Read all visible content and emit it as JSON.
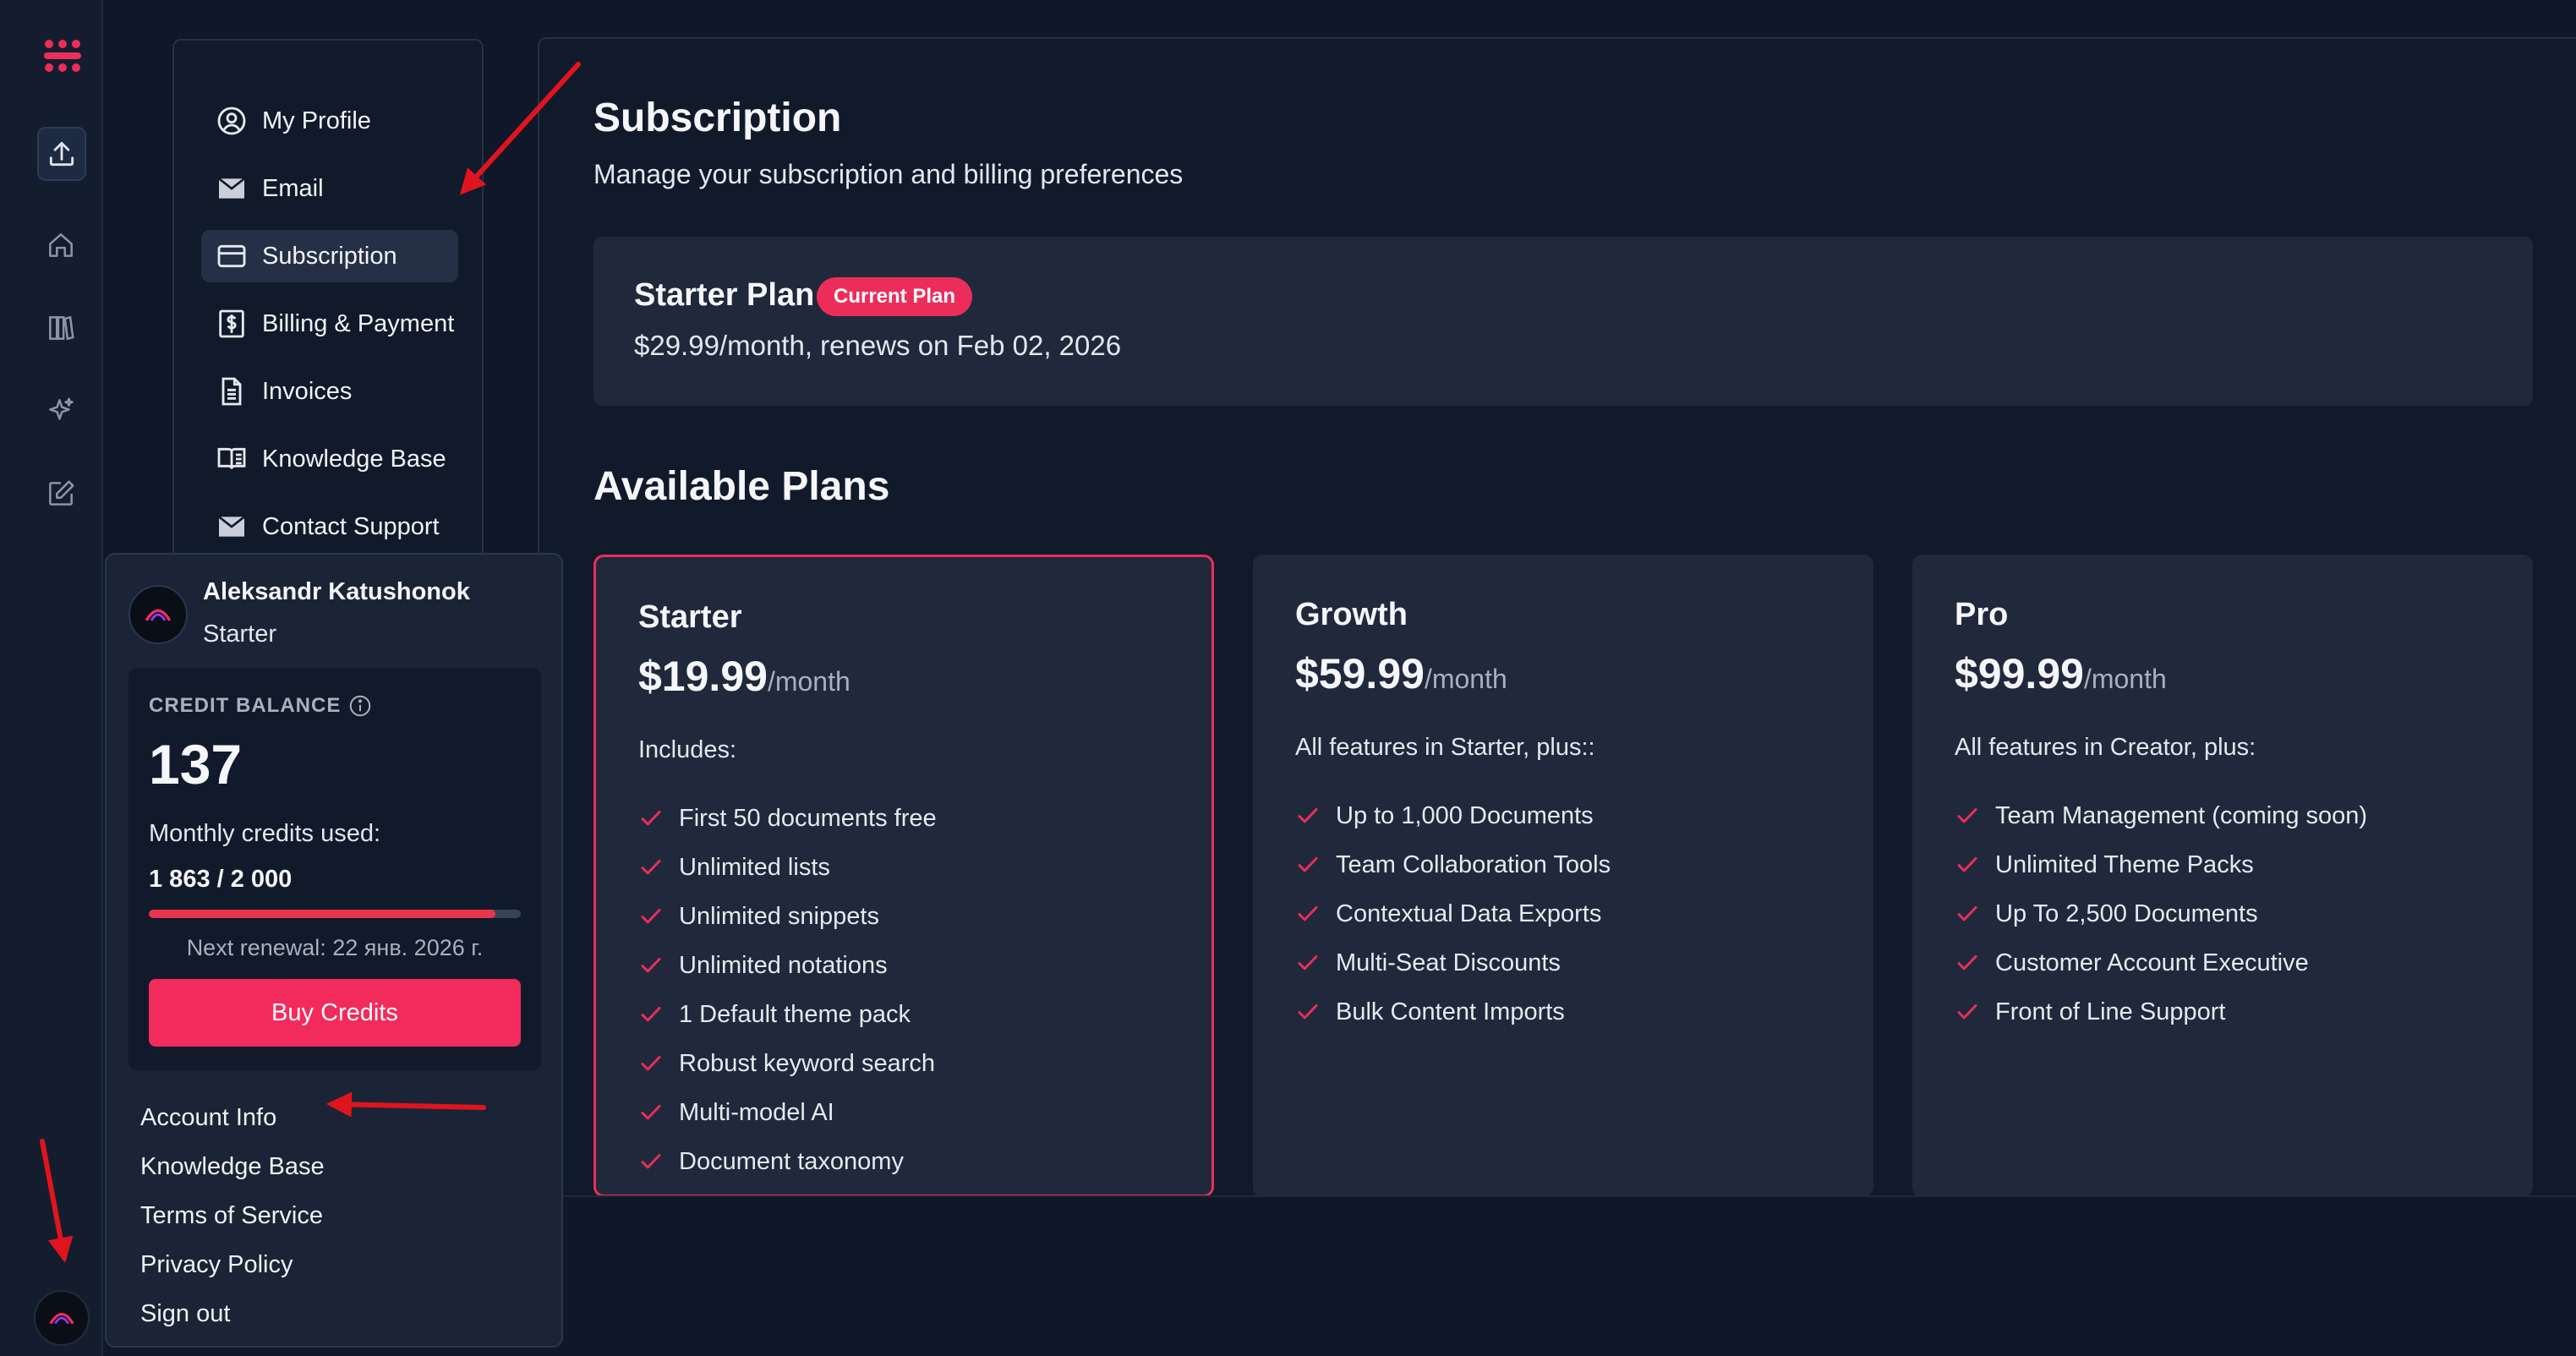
{
  "rail": {
    "items": [
      "upload-icon",
      "home-icon",
      "library-icon",
      "sparkle-icon",
      "edit-icon"
    ],
    "accent": "#ec2d5a"
  },
  "settings_nav": {
    "items": [
      {
        "label": "My Profile",
        "icon": "user-circle-icon"
      },
      {
        "label": "Email",
        "icon": "mail-icon"
      },
      {
        "label": "Subscription",
        "icon": "credit-card-icon",
        "active": true
      },
      {
        "label": "Billing & Payment",
        "icon": "billing-icon"
      },
      {
        "label": "Invoices",
        "icon": "document-icon"
      },
      {
        "label": "Knowledge Base",
        "icon": "book-icon"
      },
      {
        "label": "Contact Support",
        "icon": "mail-icon"
      }
    ]
  },
  "main": {
    "title": "Subscription",
    "subtitle": "Manage your subscription and billing preferences",
    "current_plan": {
      "name": "Starter Plan",
      "badge": "Current Plan",
      "description": "$29.99/month, renews on Feb 02, 2026"
    },
    "available_title": "Available Plans",
    "plans": [
      {
        "name": "Starter",
        "price": "$19.99",
        "period": "/month",
        "intro": "Includes:",
        "features": [
          "First 50 documents free",
          "Unlimited lists",
          "Unlimited snippets",
          "Unlimited notations",
          "1 Default theme pack",
          "Robust keyword search",
          "Multi-model AI",
          "Document taxonomy"
        ]
      },
      {
        "name": "Growth",
        "price": "$59.99",
        "period": "/month",
        "intro": "All features in Starter, plus::",
        "features": [
          "Up to 1,000 Documents",
          "Team Collaboration Tools",
          "Contextual Data Exports",
          "Multi-Seat Discounts",
          "Bulk Content Imports"
        ]
      },
      {
        "name": "Pro",
        "price": "$99.99",
        "period": "/month",
        "intro": "All features in Creator, plus:",
        "features": [
          "Team Management (coming soon)",
          "Unlimited Theme Packs",
          "Up To 2,500 Documents",
          "Customer Account Executive",
          "Front of Line Support"
        ]
      }
    ]
  },
  "account_popover": {
    "user_name": "Aleksandr Katushonok",
    "user_plan": "Starter",
    "credit_label": "CREDIT BALANCE",
    "credit_value": "137",
    "used_label": "Monthly credits used:",
    "used_value": "1 863 / 2 000",
    "used_fraction": 0.9315,
    "renewal": "Next renewal: 22 янв. 2026 г.",
    "buy_button": "Buy Credits",
    "links": [
      "Account Info",
      "Knowledge Base",
      "Terms of Service",
      "Privacy Policy",
      "Sign out"
    ]
  },
  "colors": {
    "background": "#0f1728",
    "card": "#1f293b",
    "accent": "#ec2d5a",
    "annotation_arrow": "#e0141e"
  }
}
